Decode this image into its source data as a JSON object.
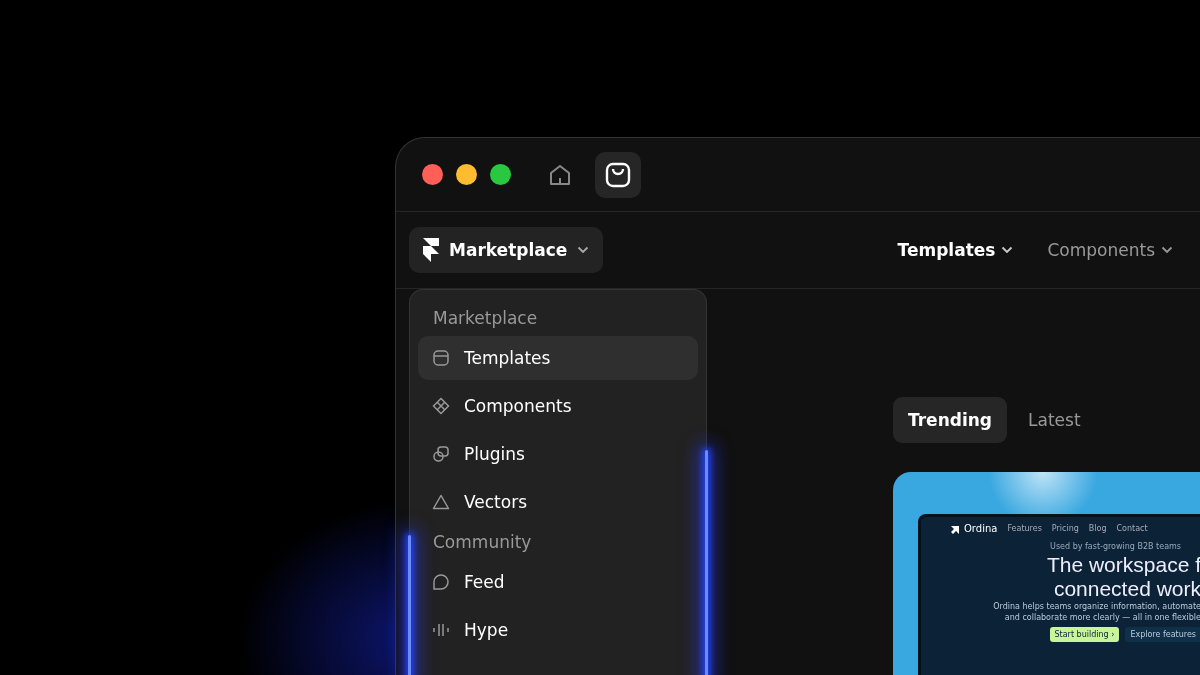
{
  "toolbar": [
    {
      "kind": "home",
      "selected": false
    },
    {
      "kind": "store",
      "selected": true
    }
  ],
  "nav": {
    "menu_button": {
      "label": "Marketplace",
      "expanded": true
    },
    "links": [
      {
        "label": "Templates",
        "selected": true
      },
      {
        "label": "Components",
        "selected": false
      }
    ]
  },
  "dropdown": {
    "sections": [
      {
        "heading": "Marketplace",
        "items": [
          {
            "label": "Templates",
            "kind": "template",
            "selected": true
          },
          {
            "label": "Components",
            "kind": "component",
            "selected": false
          },
          {
            "label": "Plugins",
            "kind": "plugin",
            "selected": false
          },
          {
            "label": "Vectors",
            "kind": "vector",
            "selected": false
          }
        ]
      },
      {
        "heading": "Community",
        "items": [
          {
            "label": "Feed",
            "kind": "feed",
            "selected": false
          },
          {
            "label": "Hype",
            "kind": "hype",
            "selected": false
          }
        ]
      }
    ]
  },
  "filter_tabs": [
    {
      "label": "Trending",
      "selected": true
    },
    {
      "label": "Latest",
      "selected": false
    }
  ],
  "template_preview": {
    "brand": "Ordina",
    "links": [
      "Features",
      "Pricing",
      "Blog",
      "Contact"
    ],
    "eyebrow": "Used by fast-growing B2B teams",
    "headline": [
      "The workspace f",
      "connected work"
    ],
    "description": [
      "Ordina helps teams organize information, automate",
      "and collaborate more clearly — all in one flexible"
    ],
    "buttons": [
      {
        "label": "Start building ›",
        "primary": true
      },
      {
        "label": "Explore features",
        "primary": false
      }
    ]
  }
}
